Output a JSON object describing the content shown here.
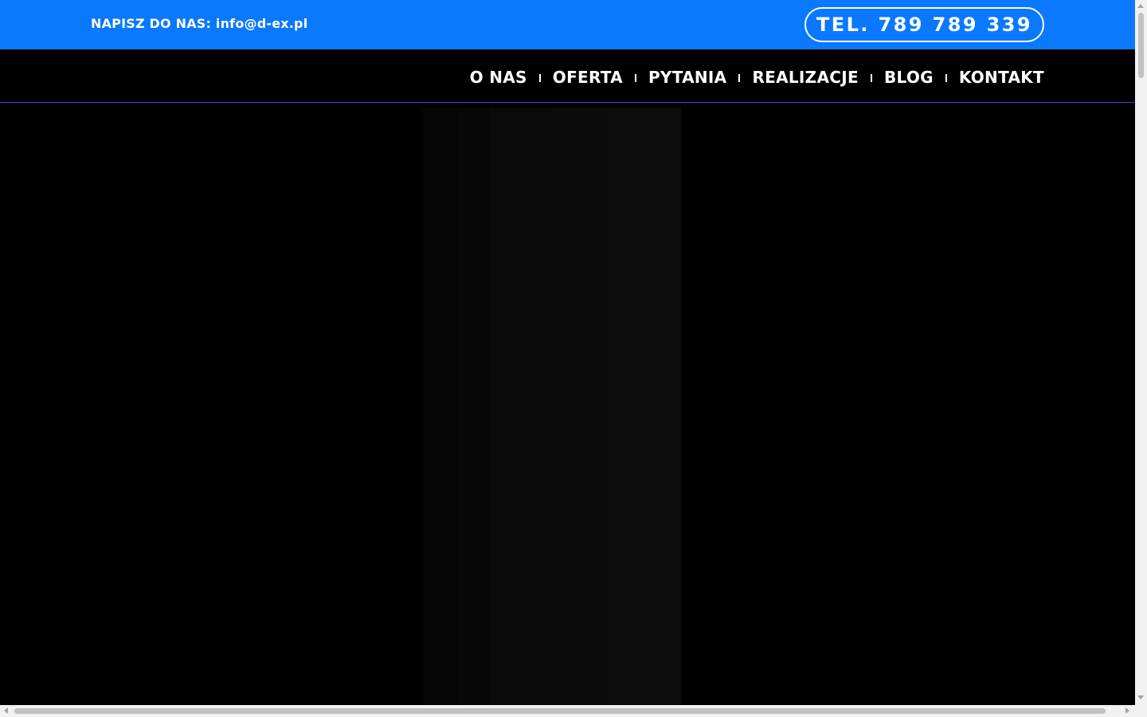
{
  "topbar": {
    "email_label": "NAPISZ DO NAS:",
    "email_value": "info@d-ex.pl",
    "phone_label": "TEL. 789 789 339",
    "background_color": "#0a78ff"
  },
  "nav": {
    "items": [
      {
        "label": "O NAS"
      },
      {
        "label": "OFERTA"
      },
      {
        "label": "PYTANIA"
      },
      {
        "label": "REALIZACJE"
      },
      {
        "label": "BLOG"
      },
      {
        "label": "KONTAKT"
      }
    ],
    "border_color": "#2e56d6"
  },
  "hero": {
    "background_color": "#000000"
  },
  "icons": {
    "scroll_up": "chevron-up-icon",
    "scroll_down": "chevron-down-icon",
    "scroll_left": "chevron-left-icon",
    "scroll_right": "chevron-right-icon"
  }
}
